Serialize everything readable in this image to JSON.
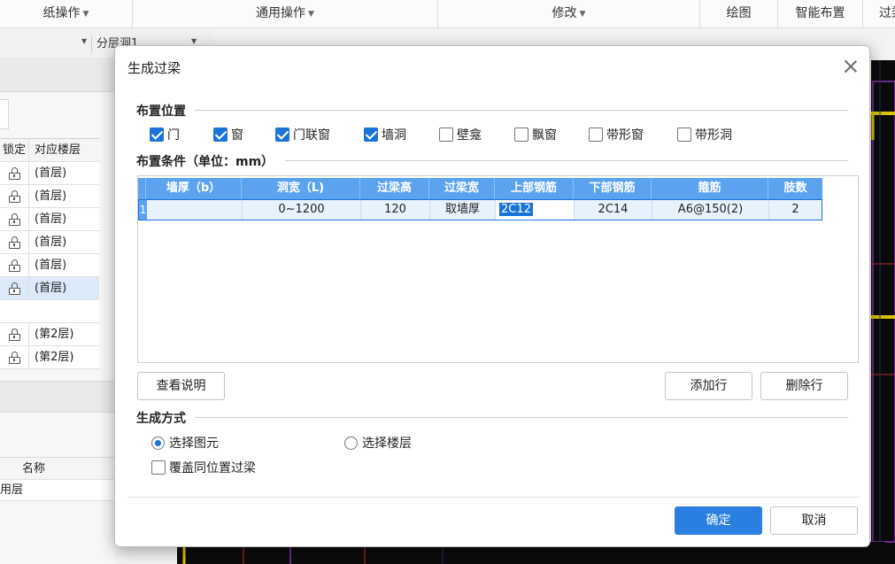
{
  "ribbon": {
    "groups": [
      {
        "label": "纸操作",
        "arrow": "▼"
      },
      {
        "label": "通用操作",
        "arrow": "▼"
      },
      {
        "label": "修改",
        "arrow": "▼"
      },
      {
        "label": "绘图",
        "arrow": ""
      },
      {
        "label": "智能布置",
        "arrow": ""
      },
      {
        "label": "过梁",
        "arrow": ""
      }
    ]
  },
  "toolbar2": {
    "dropdown_label": "分层洞1"
  },
  "floor_table": {
    "headers": [
      "锁定",
      "对应楼层"
    ],
    "rows": [
      {
        "floor": "(首层)"
      },
      {
        "floor": "(首层)"
      },
      {
        "floor": "(首层)"
      },
      {
        "floor": "(首层)"
      },
      {
        "floor": "(首层)"
      },
      {
        "floor": "(首层)"
      },
      {
        "floor": ""
      },
      {
        "floor": "(第2层)"
      },
      {
        "floor": "(第2层)"
      }
    ]
  },
  "name_panel": {
    "header": "名称",
    "row_label": "用层"
  },
  "dialog": {
    "title": "生成过梁",
    "section_position": "布置位置",
    "checkboxes": [
      {
        "label": "门",
        "checked": true
      },
      {
        "label": "窗",
        "checked": true
      },
      {
        "label": "门联窗",
        "checked": true
      },
      {
        "label": "墙洞",
        "checked": true
      },
      {
        "label": "壁龛",
        "checked": false
      },
      {
        "label": "飘窗",
        "checked": false
      },
      {
        "label": "带形窗",
        "checked": false
      },
      {
        "label": "带形洞",
        "checked": false
      }
    ],
    "section_condition": "布置条件（单位：mm）",
    "grid": {
      "headers": [
        "墙厚（b）",
        "洞宽（L)",
        "过梁高",
        "过梁宽",
        "上部钢筋",
        "下部钢筋",
        "箍筋",
        "肢数"
      ],
      "rows": [
        {
          "num": "1",
          "cells": [
            "",
            "0~1200",
            "120",
            "取墙厚",
            "2C12",
            "2C14",
            "A6@150(2)",
            "2"
          ]
        }
      ]
    },
    "btn_help": "查看说明",
    "btn_add_row": "添加行",
    "btn_delete_row": "删除行",
    "section_method": "生成方式",
    "radio_select_element": "选择图元",
    "radio_select_floor": "选择楼层",
    "radio_selected": "select_element",
    "checkbox_override": {
      "label": "覆盖同位置过梁",
      "checked": false
    },
    "btn_ok": "确定",
    "btn_cancel": "取消"
  },
  "colors": {
    "accent": "#1a73d9",
    "grid_header": "#5ba3ef",
    "primary_button": "#2b7fe0"
  }
}
